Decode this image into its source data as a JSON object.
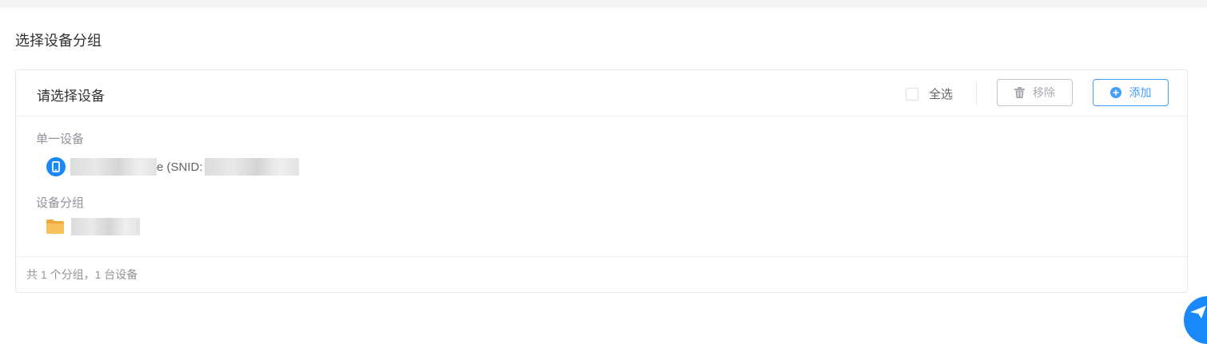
{
  "page": {
    "title": "选择设备分组"
  },
  "panel": {
    "title": "请选择设备",
    "select_all_label": "全选",
    "remove_label": "移除",
    "add_label": "添加",
    "groups": [
      {
        "label": "单一设备",
        "item_text": "e (SNID:",
        "item_icon": "mobile-phone-icon"
      },
      {
        "label": "设备分组",
        "item_icon": "folder-icon"
      }
    ],
    "footer": "共 1 个分组，1 台设备"
  },
  "colors": {
    "accent": "#409eff",
    "device_icon_bg": "#1989fa",
    "folder": "#f7b84b"
  }
}
